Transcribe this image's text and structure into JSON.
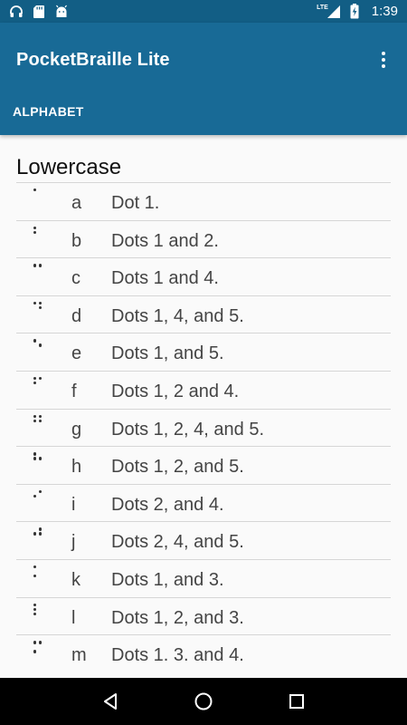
{
  "status_bar": {
    "time": "1:39",
    "network": "LTE",
    "icons": [
      "headset-icon",
      "sd-card-icon",
      "android-icon",
      "signal-icon",
      "battery-charging-icon"
    ]
  },
  "app_bar": {
    "title": "PocketBraille Lite",
    "menu_icon": "overflow-menu-icon",
    "tab_label": "ALPHABET"
  },
  "section": {
    "title": "Lowercase"
  },
  "rows": [
    {
      "letter": "a",
      "description": "Dot 1.",
      "dots": [
        1
      ]
    },
    {
      "letter": "b",
      "description": "Dots 1 and 2.",
      "dots": [
        1,
        2
      ]
    },
    {
      "letter": "c",
      "description": "Dots 1 and 4.",
      "dots": [
        1,
        4
      ]
    },
    {
      "letter": "d",
      "description": "Dots 1, 4, and 5.",
      "dots": [
        1,
        4,
        5
      ]
    },
    {
      "letter": "e",
      "description": "Dots 1, and 5.",
      "dots": [
        1,
        5
      ]
    },
    {
      "letter": "f",
      "description": "Dots 1, 2 and 4.",
      "dots": [
        1,
        2,
        4
      ]
    },
    {
      "letter": "g",
      "description": "Dots 1, 2, 4, and 5.",
      "dots": [
        1,
        2,
        4,
        5
      ]
    },
    {
      "letter": "h",
      "description": "Dots 1, 2, and 5.",
      "dots": [
        1,
        2,
        5
      ]
    },
    {
      "letter": "i",
      "description": "Dots 2, and 4.",
      "dots": [
        2,
        4
      ]
    },
    {
      "letter": "j",
      "description": "Dots 2, 4, and 5.",
      "dots": [
        2,
        4,
        5
      ]
    },
    {
      "letter": "k",
      "description": "Dots 1, and 3.",
      "dots": [
        1,
        3
      ]
    },
    {
      "letter": "l",
      "description": "Dots 1, 2, and 3.",
      "dots": [
        1,
        2,
        3
      ]
    },
    {
      "letter": "m",
      "description": "Dots 1. 3. and 4.",
      "dots": [
        1,
        3,
        4
      ]
    }
  ],
  "nav_bar": {
    "buttons": [
      "back-icon",
      "home-icon",
      "recents-icon"
    ]
  },
  "colors": {
    "status_bar": "#125e85",
    "app_bar": "#186a96",
    "background": "#fafafa",
    "divider": "#d6d6d6"
  }
}
